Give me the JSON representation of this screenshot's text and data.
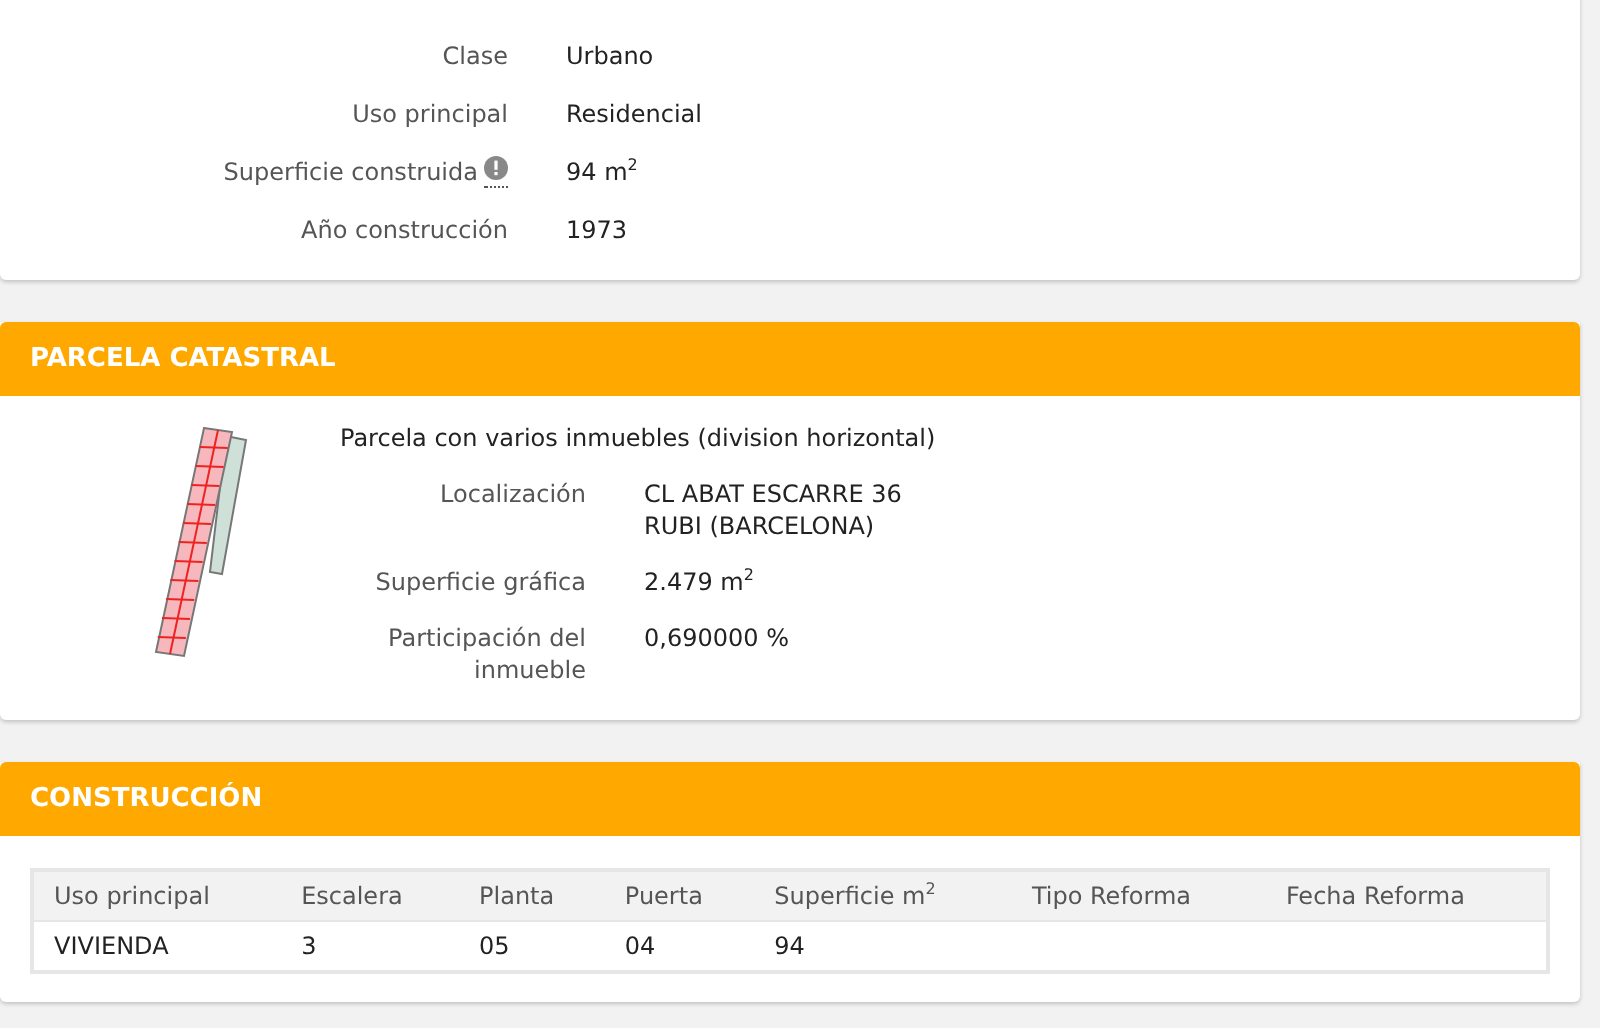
{
  "inmueble": {
    "rows": [
      {
        "label": "Clase",
        "value": "Urbano",
        "info": false
      },
      {
        "label": "Uso principal",
        "value": "Residencial",
        "info": false
      },
      {
        "label": "Superficie construida",
        "value": "94 m$^{2}$",
        "info": true
      },
      {
        "label": "Año construcción",
        "value": "1973",
        "info": false
      }
    ]
  },
  "parcela": {
    "title": "PARCELA CATASTRAL",
    "description": "Parcela con varios inmuebles (division horizontal)",
    "rows": [
      {
        "label": "Localización",
        "value": [
          "CL ABAT ESCARRE 36",
          "RUBI (BARCELONA)"
        ]
      },
      {
        "label": "Superficie gráfica",
        "value": [
          "2.479 m$^{2}$"
        ]
      },
      {
        "label": "Participación del inmueble",
        "value": [
          "0,690000 %"
        ]
      }
    ]
  },
  "construccion": {
    "title": "CONSTRUCCIÓN",
    "columns": [
      "Uso principal",
      "Escalera",
      "Planta",
      "Puerta",
      "Superficie m$^{2}$",
      "Tipo Reforma",
      "Fecha Reforma"
    ],
    "rows": [
      [
        "VIVIENDA",
        "3",
        "05",
        "04",
        "94",
        "",
        ""
      ]
    ]
  }
}
